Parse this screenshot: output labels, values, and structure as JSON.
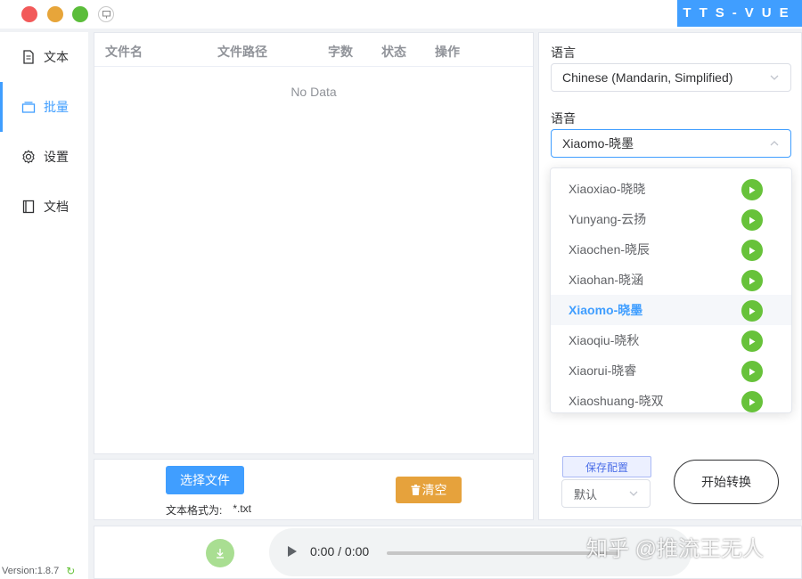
{
  "brand": "TTS-VUE",
  "sidebar": {
    "items": [
      {
        "label": "文本",
        "icon": "document-icon"
      },
      {
        "label": "批量",
        "icon": "batch-icon"
      },
      {
        "label": "设置",
        "icon": "gear-icon"
      },
      {
        "label": "文档",
        "icon": "book-icon"
      }
    ],
    "active_index": 1,
    "version": "Version:1.8.7"
  },
  "table": {
    "columns": [
      "文件名",
      "文件路径",
      "字数",
      "状态",
      "操作"
    ],
    "empty_text": "No Data"
  },
  "actions": {
    "select_file": "选择文件",
    "format_label": "文本格式为:",
    "format_value": "*.txt",
    "clear": "清空"
  },
  "settings": {
    "language_label": "语言",
    "language_value": "Chinese (Mandarin, Simplified)",
    "voice_label": "语音",
    "voice_value": "Xiaomo-晓墨",
    "voice_options": [
      "Xiaoxiao-晓晓",
      "Yunyang-云扬",
      "Xiaochen-晓辰",
      "Xiaohan-晓涵",
      "Xiaomo-晓墨",
      "Xiaoqiu-晓秋",
      "Xiaorui-晓睿",
      "Xiaoshuang-晓双"
    ],
    "selected_voice_index": 4,
    "save_config": "保存配置",
    "config_value": "默认",
    "start": "开始转换"
  },
  "player": {
    "time": "0:00 / 0:00"
  },
  "watermark": "知乎 @推流王无人",
  "colors": {
    "primary": "#409eff",
    "warning": "#e6a23c",
    "success": "#67c23a"
  }
}
